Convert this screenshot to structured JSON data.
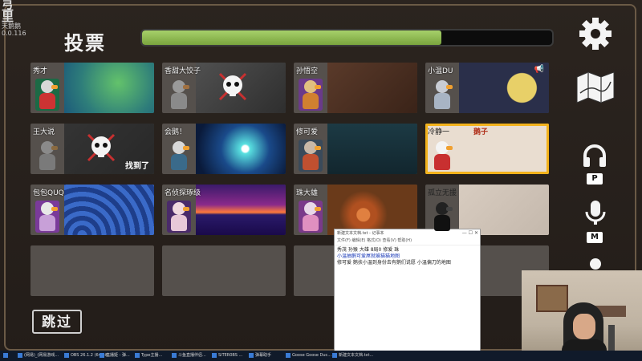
{
  "header": {
    "title": "投票",
    "vote_progress": 0.73
  },
  "logo": {
    "line1": "弖里",
    "line2": "天鹅鹅",
    "line3": "0.0.116"
  },
  "players": [
    {
      "name": "秀才",
      "state": "alive"
    },
    {
      "name": "香甜大饺子",
      "state": "dead"
    },
    {
      "name": "孙悟空",
      "state": "alive"
    },
    {
      "name": "小温DU",
      "state": "alive"
    },
    {
      "name": "王大说",
      "state": "dead",
      "badge": "找到了"
    },
    {
      "name": "会鹅！",
      "state": "alive"
    },
    {
      "name": "修可爱",
      "state": "alive"
    },
    {
      "name": "冷静一",
      "state": "selected",
      "tag": "鹅子"
    },
    {
      "name": "包包QUQ",
      "state": "alive"
    },
    {
      "name": "名侦探琢级",
      "state": "alive"
    },
    {
      "name": "珠大雄",
      "state": "alive"
    },
    {
      "name": "孤立无援",
      "state": "alive"
    }
  ],
  "skip_label": "跳过",
  "keys": {
    "push_to_talk": "P",
    "mute": "M"
  },
  "notepad": {
    "title": "新建文本文档.txt - 记事本",
    "menu": "文件(F)  编辑(E)  格式(O)  查看(V)  帮助(H)",
    "lines": [
      "秀茂 孙猴 大雄 8局0 修爱 珠",
      "小温抽鹅可爱屌就躲猫猫地图",
      "修可爱 鹅扶小温到身份去有鹅们说愿 小温偏刀的地图"
    ]
  },
  "taskbar": {
    "items": [
      "(网易)_(网易游戏...",
      "OBS 26.1.2 (64 bit...",
      "直播姬 - 弹...",
      "Type主播...",
      "斗鱼直播伴侣...",
      "SiTER0BS ...",
      "弹幕助手",
      "Goose Goose Duc...",
      "新建文本文档.txt..."
    ]
  },
  "colors": {
    "accent": "#f3b21c",
    "progress": "#8fbf4f"
  }
}
